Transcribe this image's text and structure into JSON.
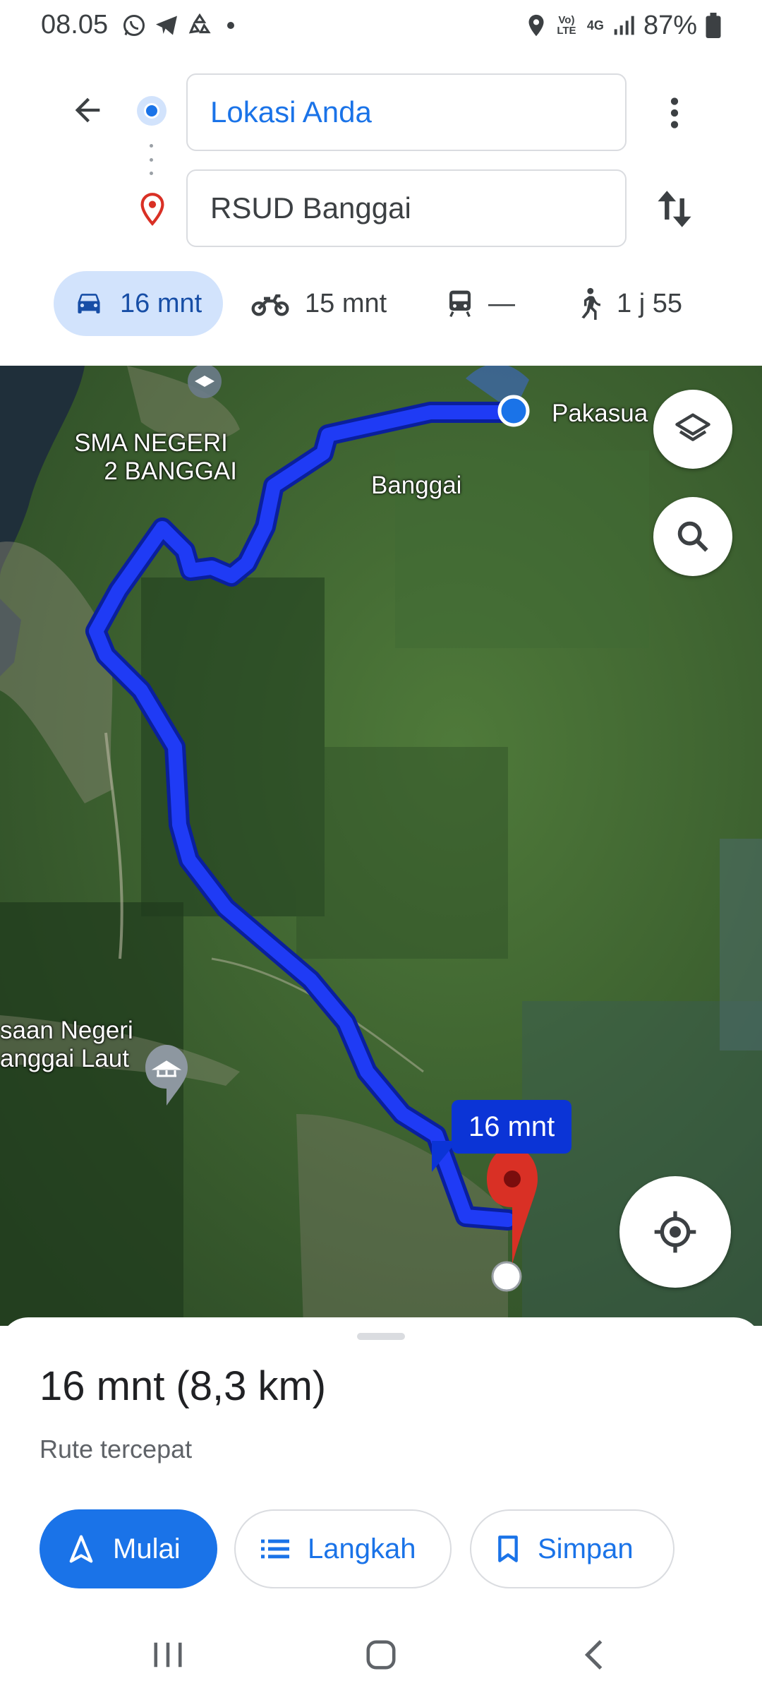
{
  "status_bar": {
    "time": "08.05",
    "left_icons": [
      "whatsapp-icon",
      "telegram-icon",
      "recycle-icon",
      "dot-icon"
    ],
    "right_icons": [
      "location-icon",
      "volte-icon",
      "4g-icon",
      "signal-icon",
      "battery-icon"
    ],
    "volte_label": "Vo) LTE",
    "network_label": "4G",
    "battery": "87%"
  },
  "directions": {
    "origin": "Lokasi Anda",
    "destination": "RSUD Banggai"
  },
  "modes": [
    {
      "name": "car",
      "label": "16 mnt",
      "selected": true
    },
    {
      "name": "motorcycle",
      "label": "15 mnt",
      "selected": false
    },
    {
      "name": "transit",
      "label": "—",
      "selected": false
    },
    {
      "name": "walk",
      "label": "1 j 55",
      "selected": false
    }
  ],
  "map": {
    "labels": {
      "pakasua": "Pakasua",
      "banggai": "Banggai",
      "sma_line1": "SMA NEGERI",
      "sma_line2": "2 BANGGAI",
      "museum_line1": "saan Negeri",
      "museum_line2": "anggai Laut"
    },
    "route_time": "16 mnt",
    "route_color": "#0b34d6"
  },
  "sheet": {
    "summary": "16 mnt (8,3 km)",
    "subtitle": "Rute tercepat",
    "start_label": "Mulai",
    "steps_label": "Langkah",
    "save_label": "Simpan"
  },
  "colors": {
    "accent": "#1a73e8",
    "mode_selected_bg": "#d2e3fc",
    "pin": "#d93025"
  }
}
